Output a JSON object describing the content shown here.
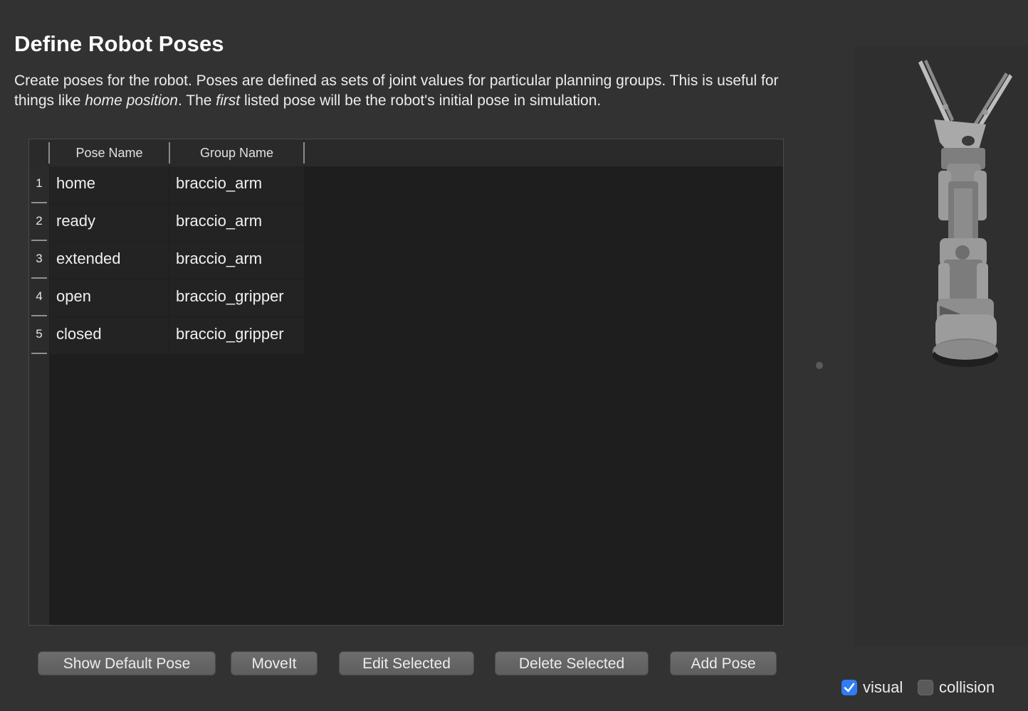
{
  "page": {
    "title": "Define Robot Poses",
    "description": {
      "part1": "Create poses for the robot. Poses are defined as sets of joint values for particular planning groups. This is useful for things like ",
      "em1": "home position",
      "part2": ". The ",
      "em2": "first",
      "part3": " listed pose will be the robot's initial pose in simulation."
    }
  },
  "table": {
    "columns": [
      "Pose Name",
      "Group Name"
    ],
    "rows": [
      {
        "num": "1",
        "pose": "home",
        "group": "braccio_arm"
      },
      {
        "num": "2",
        "pose": "ready",
        "group": "braccio_arm"
      },
      {
        "num": "3",
        "pose": "extended",
        "group": "braccio_arm"
      },
      {
        "num": "4",
        "pose": "open",
        "group": "braccio_gripper"
      },
      {
        "num": "5",
        "pose": "closed",
        "group": "braccio_gripper"
      }
    ]
  },
  "buttons": {
    "show_default": "Show Default Pose",
    "moveit": "MoveIt",
    "edit": "Edit Selected",
    "delete": "Delete Selected",
    "add": "Add Pose"
  },
  "viewer": {
    "visual_label": "visual",
    "visual_checked": true,
    "collision_label": "collision",
    "collision_checked": false
  },
  "colors": {
    "background": "#323232",
    "table_bg": "#1e1e1e",
    "checkbox_accent": "#2f7cf6"
  }
}
